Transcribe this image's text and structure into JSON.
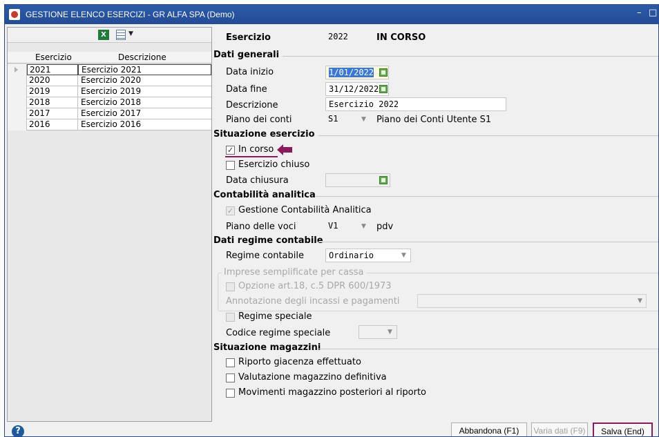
{
  "window": {
    "title": "GESTIONE ELENCO ESERCIZI - GR ALFA SPA (Demo)",
    "minimize": "–",
    "maximize": "□"
  },
  "left_panel": {
    "columns": [
      "Esercizio",
      "Descrizione"
    ],
    "rows": [
      {
        "year": "2021",
        "desc": "Esercizio 2021"
      },
      {
        "year": "2020",
        "desc": "Esercizio 2020"
      },
      {
        "year": "2019",
        "desc": "Esercizio 2019"
      },
      {
        "year": "2018",
        "desc": "Esercizio 2018"
      },
      {
        "year": "2017",
        "desc": "Esercizio 2017"
      },
      {
        "year": "2016",
        "desc": "Esercizio 2016"
      }
    ],
    "excel_icon": "X",
    "selected_row": 0
  },
  "header": {
    "label": "Esercizio",
    "value": "2022",
    "status": "IN CORSO"
  },
  "dati_generali": {
    "title": "Dati generali",
    "data_inizio_label": "Data inizio",
    "data_inizio_value": "1/01/2022",
    "data_fine_label": "Data fine",
    "data_fine_value": "31/12/2022",
    "descrizione_label": "Descrizione",
    "descrizione_value": "Esercizio 2022",
    "piano_label": "Piano dei conti",
    "piano_value": "S1",
    "piano_desc": "Piano dei Conti Utente S1"
  },
  "situazione_esercizio": {
    "title": "Situazione esercizio",
    "in_corso": "In corso",
    "in_corso_checked": true,
    "esercizio_chiuso": "Esercizio chiuso",
    "data_chiusura_label": "Data chiusura"
  },
  "contabilita_analitica": {
    "title": "Contabilità analitica",
    "gestione": "Gestione Contabilità Analitica",
    "piano_voci_label": "Piano delle voci",
    "piano_voci_value": "V1",
    "piano_voci_desc": "pdv"
  },
  "dati_regime": {
    "title": "Dati regime contabile",
    "regime_label": "Regime contabile",
    "regime_value": "Ordinario"
  },
  "imprese_semplificate": {
    "title": "Imprese semplificate per cassa",
    "opzione": "Opzione art.18, c.5 DPR 600/1973",
    "annotazione": "Annotazione degli incassi e pagamenti"
  },
  "regime_speciale": {
    "label": "Regime speciale",
    "codice_label": "Codice regime speciale"
  },
  "situazione_magazzini": {
    "title": "Situazione magazzini",
    "riporto": "Riporto giacenza effettuato",
    "valutazione": "Valutazione magazzino definitiva",
    "movimenti": "Movimenti magazzino posteriori al riporto"
  },
  "footer": {
    "help": "?",
    "abbandona": "Abbandona (F1)",
    "varia": "Varia dati (F9)",
    "salva": "Salva (End)"
  },
  "colors": {
    "titlebar": "#2c5aa8",
    "highlight": "#8a1a5a"
  }
}
